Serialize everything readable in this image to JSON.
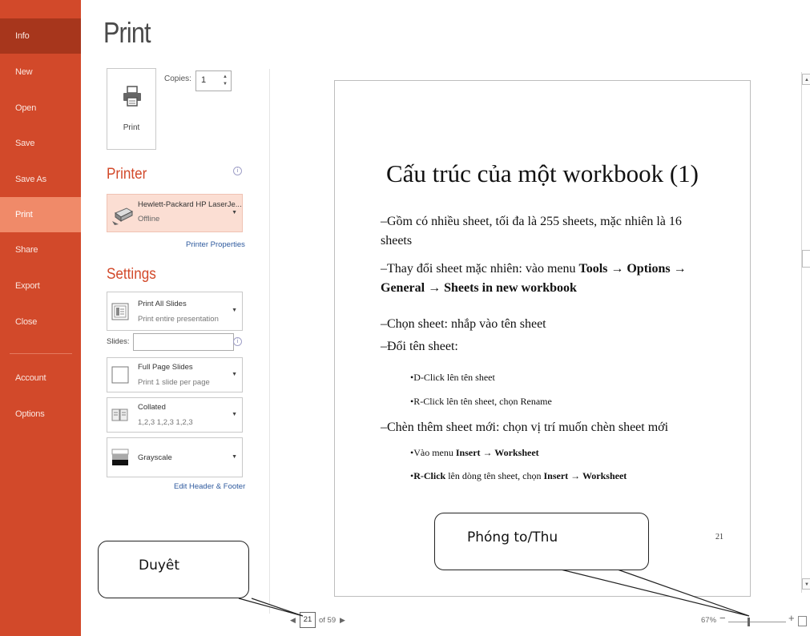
{
  "sidebar": {
    "items": [
      {
        "label": "Info"
      },
      {
        "label": "New"
      },
      {
        "label": "Open"
      },
      {
        "label": "Save"
      },
      {
        "label": "Save As"
      },
      {
        "label": "Print"
      },
      {
        "label": "Share"
      },
      {
        "label": "Export"
      },
      {
        "label": "Close"
      },
      {
        "label": "Account"
      },
      {
        "label": "Options"
      }
    ],
    "active": "Print",
    "colors": {
      "background": "#d2492a",
      "active": "#f08a69",
      "info": "#a7361c"
    }
  },
  "page_title": "Print",
  "print_button": {
    "label": "Print"
  },
  "copies": {
    "label": "Copies:",
    "value": "1"
  },
  "printer": {
    "heading": "Printer",
    "name": "Hewlett-Packard HP LaserJe...",
    "status": "Offline",
    "properties_link": "Printer Properties"
  },
  "settings": {
    "heading": "Settings",
    "slide_range": {
      "main": "Print All Slides",
      "sub": "Print entire presentation"
    },
    "slides_label": "Slides:",
    "slides_value": "",
    "layout": {
      "main": "Full Page Slides",
      "sub": "Print 1 slide per page"
    },
    "collation": {
      "main": "Collated",
      "sub": "1,2,3   1,2,3   1,2,3"
    },
    "color": {
      "main": "Grayscale"
    },
    "header_footer_link": "Edit Header & Footer"
  },
  "preview": {
    "title": "Cấu trúc của một workbook (1)",
    "bullets": [
      {
        "level": 1,
        "parts": [
          {
            "t": "–Gồm có nhiều sheet, tối đa là 255 sheets, mặc nhiên là 16 sheets"
          }
        ]
      },
      {
        "level": 1,
        "parts": [
          {
            "t": "–Thay đổi sheet mặc nhiên: vào menu "
          },
          {
            "t": "Tools → Options → General → Sheets in new workbook",
            "b": true
          }
        ]
      },
      {
        "level": 1,
        "parts": [
          {
            "t": "–Chọn sheet: nhắp vào tên sheet"
          }
        ]
      },
      {
        "level": 1,
        "parts": [
          {
            "t": "–Đổi tên sheet:"
          }
        ]
      },
      {
        "level": 2,
        "parts": [
          {
            "t": "•D-Click lên tên sheet"
          }
        ]
      },
      {
        "level": 2,
        "parts": [
          {
            "t": "•R-Click lên tên sheet, chọn Rename"
          }
        ]
      },
      {
        "level": 1,
        "parts": [
          {
            "t": "–Chèn thêm sheet mới: chọn vị trí muốn chèn sheet mới"
          }
        ]
      },
      {
        "level": 2,
        "parts": [
          {
            "t": "•Vào menu "
          },
          {
            "t": "Insert → Worksheet",
            "b": true
          }
        ]
      },
      {
        "level": 2,
        "parts": [
          {
            "t": "•"
          },
          {
            "t": "R-Click",
            "b": true
          },
          {
            "t": " lên dòng tên sheet, chọn "
          },
          {
            "t": "Insert → Worksheet",
            "b": true
          }
        ]
      }
    ],
    "page_number": "21"
  },
  "nav": {
    "current_page": "21",
    "of_text": "of 59",
    "prev_icon": "◀",
    "next_icon": "▶"
  },
  "zoom": {
    "percent": "67%",
    "minus": "−",
    "plus": "+",
    "level": 0.67
  },
  "callouts": {
    "left": "Duyêt",
    "right": "Phóng to/Thu"
  }
}
